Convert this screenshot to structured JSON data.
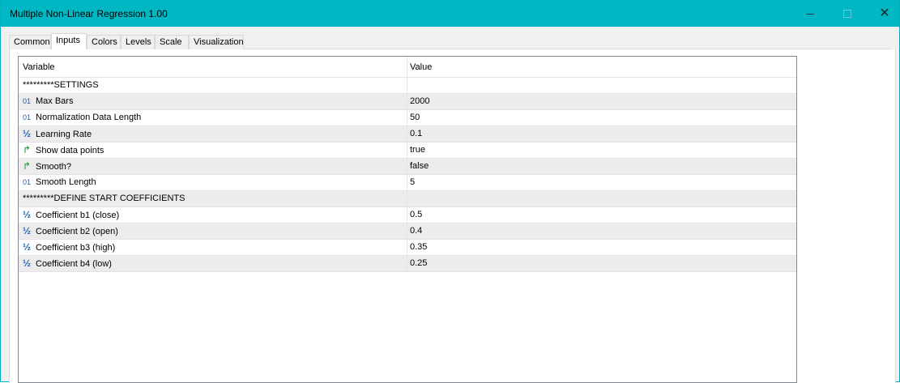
{
  "window": {
    "title": "Multiple Non-Linear Regression 1.00"
  },
  "tabs": [
    {
      "label": "Common"
    },
    {
      "label": "Inputs"
    },
    {
      "label": "Colors"
    },
    {
      "label": "Levels"
    },
    {
      "label": "Scale"
    },
    {
      "label": "Visualization"
    }
  ],
  "active_tab": "Inputs",
  "table": {
    "headers": {
      "variable": "Variable",
      "value": "Value"
    },
    "rows": [
      {
        "icon": "",
        "variable": "*********SETTINGS",
        "value": ""
      },
      {
        "icon": "int-icon",
        "glyph": "01",
        "variable": "Max Bars",
        "value": "2000"
      },
      {
        "icon": "int-icon",
        "glyph": "01",
        "variable": "Normalization Data Length",
        "value": "50"
      },
      {
        "icon": "double-icon",
        "glyph": "½",
        "variable": "Learning Rate",
        "value": "0.1"
      },
      {
        "icon": "bool-icon",
        "glyph": "↱",
        "variable": "Show data points",
        "value": "true"
      },
      {
        "icon": "bool-icon",
        "glyph": "↱",
        "variable": "Smooth?",
        "value": "false"
      },
      {
        "icon": "int-icon",
        "glyph": "01",
        "variable": "Smooth Length",
        "value": "5"
      },
      {
        "icon": "",
        "variable": "*********DEFINE START COEFFICIENTS",
        "value": ""
      },
      {
        "icon": "double-icon",
        "glyph": "½",
        "variable": "Coefficient b1 (close)",
        "value": "0.5"
      },
      {
        "icon": "double-icon",
        "glyph": "½",
        "variable": "Coefficient b2 (open)",
        "value": "0.4"
      },
      {
        "icon": "double-icon",
        "glyph": "½",
        "variable": "Coefficient b3 (high)",
        "value": "0.35"
      },
      {
        "icon": "double-icon",
        "glyph": "½",
        "variable": "Coefficient b4 (low)",
        "value": "0.25"
      }
    ]
  },
  "colors": {
    "titlebar": "#00b7c3",
    "alt_row": "#ececec",
    "int_icon": "#1e5fa8",
    "bool_icon": "#1b9a2e"
  }
}
